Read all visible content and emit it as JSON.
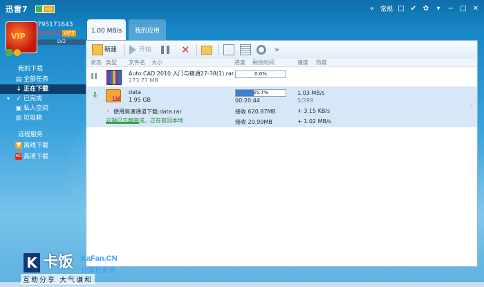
{
  "titlebar": {
    "app_title": "迅雷7",
    "vip_badge": "vip",
    "right_label": "常规"
  },
  "user": {
    "id": "795171643",
    "name": "hello4321",
    "vip": "VIP3",
    "level": "LV2"
  },
  "nav": {
    "my_downloads": "我的下载",
    "items": [
      {
        "label": "全部任务"
      },
      {
        "label": "正在下载"
      },
      {
        "label": "已完成"
      },
      {
        "label": "私人空间"
      },
      {
        "label": "垃圾箱"
      }
    ],
    "remote_section": "远程服务",
    "remote_items": [
      {
        "label": "离线下载"
      },
      {
        "label": "高清下载"
      }
    ]
  },
  "tabs": {
    "speed": "1.00 MB/s",
    "apps": "我的应用"
  },
  "toolbar": {
    "new": "新建",
    "start": "开始"
  },
  "columns": {
    "status": "状态",
    "type": "类型",
    "filename": "文件名",
    "size": "大小",
    "progress": "进度",
    "remaining": "剩余时间",
    "speed": "速度",
    "heat": "热度"
  },
  "tasks": [
    {
      "name": "Auto.CAD.2010.入门与精通27-38(1).rar",
      "size": "273.77 MB",
      "progress": 0.0,
      "progress_label": "0.0%"
    },
    {
      "name": "data",
      "size": "1.95 GB",
      "progress": 35.7,
      "progress_label": "35.7%",
      "remaining": "00:20:44",
      "speed": "1.03 MB/s",
      "sources": "5/289",
      "line2": "使用高速通道下载:data.rar",
      "recv1_label": "接收 620.87MB",
      "recv1_speed": "+ 3.15 KB/s",
      "cloud_status": "云端已下载完成，正在取回本地",
      "recv2_label": "接收 20.99MB",
      "recv2_speed": "+ 1.02 MB/s"
    }
  ],
  "watermark": {
    "k": "K",
    "brand": "卡饭",
    "site": "KaFan.CN",
    "security": "计算机安全",
    "slogan": "互助分享  大气谦和"
  },
  "colors": {
    "accent": "#1686c7",
    "active_nav": "#0d3f6a",
    "selected_row": "#d6e8f7",
    "progress_fill": "#3f7fd0",
    "cloud_green": "#2ea241"
  }
}
